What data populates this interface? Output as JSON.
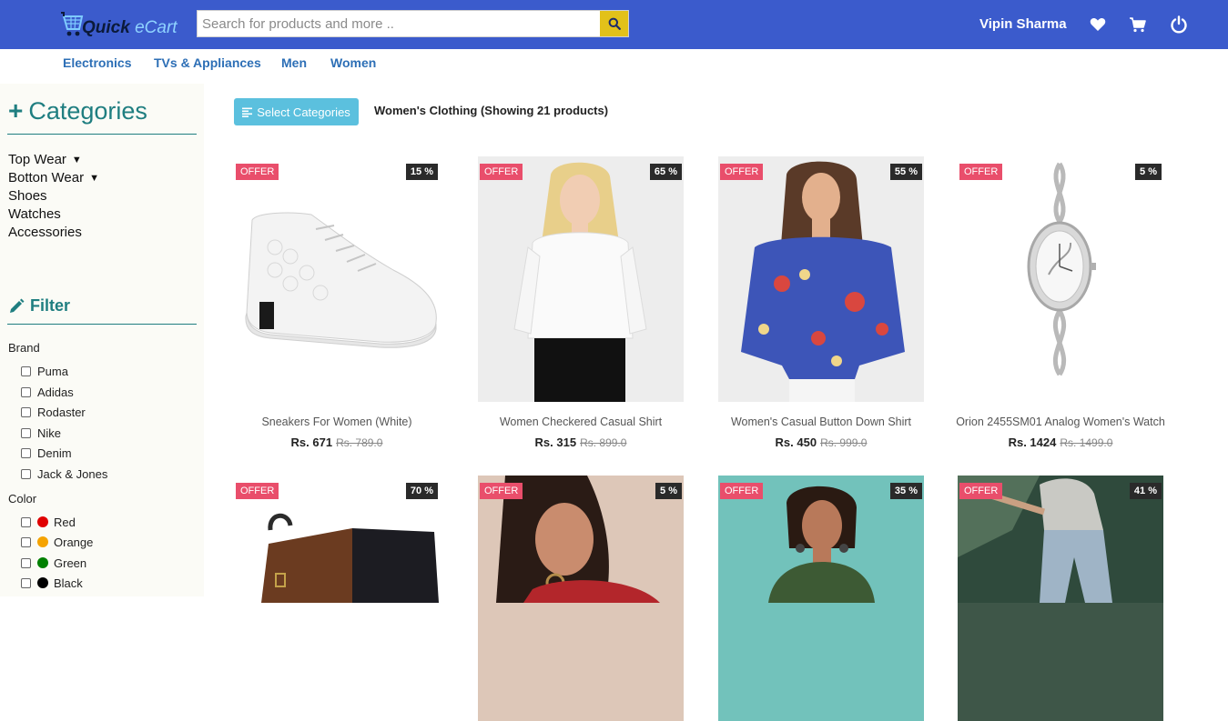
{
  "header": {
    "logo_part1": "Quick",
    "logo_part2": " eCart",
    "search_placeholder": "Search for products and more ..",
    "search_value": "",
    "user_name": "Vipin Sharma",
    "brand_color": "#3b5bcc",
    "icons": [
      "search-icon",
      "heart-icon",
      "cart-icon",
      "power-icon"
    ]
  },
  "nav": {
    "items": [
      "Electronics",
      "TVs & Appliances",
      "Men",
      "Women"
    ]
  },
  "sidebar": {
    "categories_title": "Categories",
    "categories": [
      {
        "label": "Top Wear",
        "expandable": true
      },
      {
        "label": "Botton Wear",
        "expandable": true
      },
      {
        "label": "Shoes",
        "expandable": false
      },
      {
        "label": "Watches",
        "expandable": false
      },
      {
        "label": "Accessories",
        "expandable": false
      }
    ],
    "filter_title": "Filter",
    "brand_label": "Brand",
    "brands": [
      "Puma",
      "Adidas",
      "Rodaster",
      "Nike",
      "Denim",
      "Jack & Jones"
    ],
    "color_label": "Color",
    "colors": [
      {
        "label": "Red",
        "hex": "#e00000"
      },
      {
        "label": "Orange",
        "hex": "#f5a300"
      },
      {
        "label": "Green",
        "hex": "#008000"
      },
      {
        "label": "Black",
        "hex": "#000000"
      }
    ]
  },
  "content": {
    "select_button": "Select Categories",
    "heading": "Women's Clothing (Showing 21 products)",
    "offer_label": "OFFER",
    "products": [
      {
        "name": "Sneakers For Women (White)",
        "price": "Rs. 671",
        "mrp": "Rs. 789.0",
        "discount": "15 %"
      },
      {
        "name": "Women Checkered Casual Shirt",
        "price": "Rs. 315",
        "mrp": "Rs. 899.0",
        "discount": "65 %"
      },
      {
        "name": "Women's Casual Button Down Shirt",
        "price": "Rs. 450",
        "mrp": "Rs. 999.0",
        "discount": "55 %"
      },
      {
        "name": "Orion 2455SM01 Analog Women's Watch",
        "price": "Rs. 1424",
        "mrp": "Rs. 1499.0",
        "discount": "5 %"
      },
      {
        "name": "",
        "price": "",
        "mrp": "",
        "discount": "70 %"
      },
      {
        "name": "",
        "price": "",
        "mrp": "",
        "discount": "5 %"
      },
      {
        "name": "",
        "price": "",
        "mrp": "",
        "discount": "35 %"
      },
      {
        "name": "",
        "price": "",
        "mrp": "",
        "discount": "41 %"
      }
    ]
  }
}
